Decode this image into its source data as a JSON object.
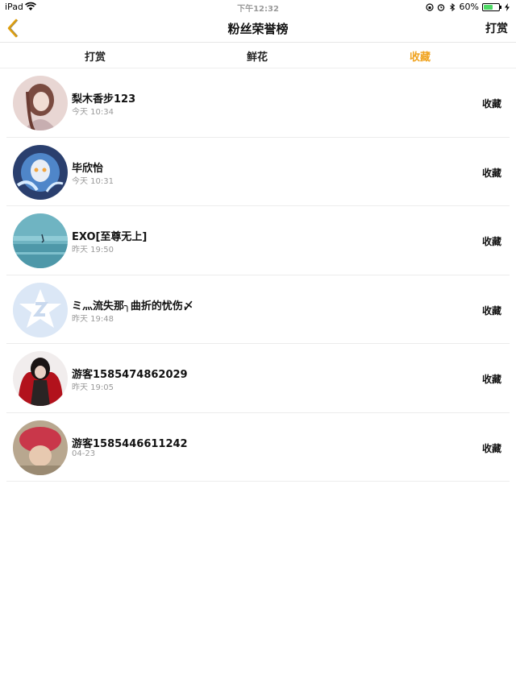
{
  "status_bar": {
    "device": "iPad",
    "time": "下午12:32",
    "battery": "60%",
    "battery_level": 0.6,
    "icons": [
      "wifi-icon",
      "rotation-lock-icon",
      "alarm-icon",
      "bluetooth-icon",
      "battery-icon",
      "charging-icon"
    ]
  },
  "nav": {
    "title": "粉丝荣誉榜",
    "right_label": "打赏",
    "back_icon": "chevron-left-icon",
    "accent_color": "#f0a31f"
  },
  "tabs": [
    {
      "label": "打赏",
      "active": false
    },
    {
      "label": "鲜花",
      "active": false
    },
    {
      "label": "收藏",
      "active": true
    }
  ],
  "rows": [
    {
      "name": "梨木香步123",
      "time": "今天 10:34",
      "action": "收藏",
      "avatar": "anime-girl-avatar"
    },
    {
      "name": "毕欣怡",
      "time": "今天 10:31",
      "action": "收藏",
      "avatar": "anime-character-blue-avatar"
    },
    {
      "name": "EXO[至尊无上]",
      "time": "昨天 19:50",
      "action": "收藏",
      "avatar": "sky-scene-avatar"
    },
    {
      "name": "ミ灬流失那╮曲折的忧伤〆",
      "time": "昨天 19:48",
      "action": "收藏",
      "avatar": "qq-default-avatar"
    },
    {
      "name": "游客1585474862029",
      "time": "昨天 19:05",
      "action": "收藏",
      "avatar": "dark-character-avatar"
    },
    {
      "name": "游客1585446611242",
      "time": "04-23",
      "action": "收藏",
      "avatar": "red-hat-photo-avatar"
    }
  ]
}
